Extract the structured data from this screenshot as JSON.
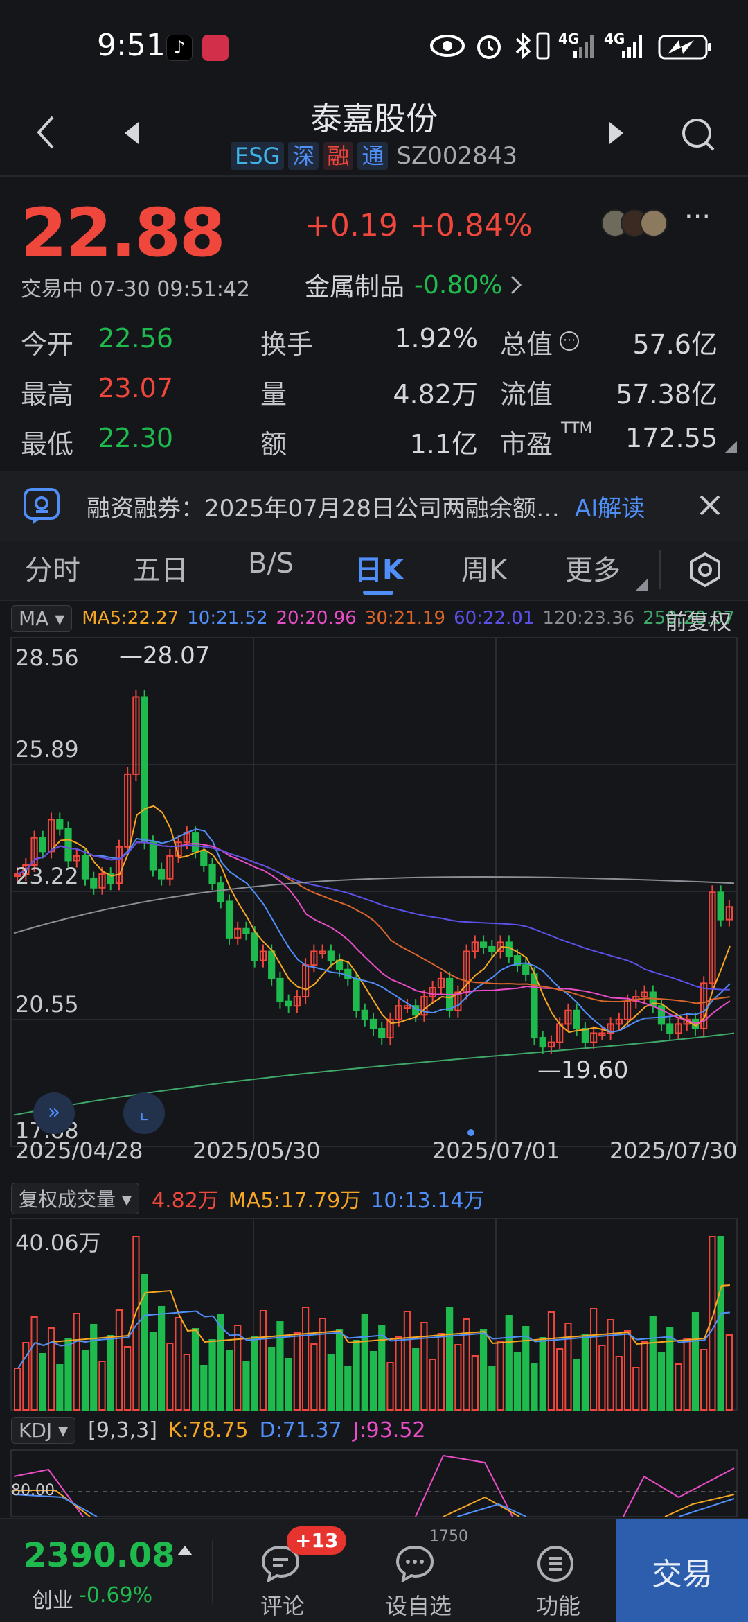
{
  "status_bar": {
    "time": "9:51",
    "net1": "4G",
    "net2": "4G"
  },
  "header": {
    "title": "泰嘉股份",
    "tags": [
      "ESG",
      "深",
      "融",
      "通"
    ],
    "code": "SZ002843"
  },
  "quote": {
    "price": "22.88",
    "change": "+0.19",
    "change_pct": "+0.84%",
    "status": "交易中 07-30 09:51:42",
    "sector": "金属制品",
    "sector_pct": "-0.80%"
  },
  "stats": [
    [
      {
        "label": "今开",
        "value": "22.56",
        "color": "green"
      },
      {
        "label": "换手",
        "value": "1.92%"
      },
      {
        "label": "总值",
        "value": "57.6亿"
      }
    ],
    [
      {
        "label": "最高",
        "value": "23.07",
        "color": "red"
      },
      {
        "label": "量",
        "value": "4.82万"
      },
      {
        "label": "流值",
        "value": "57.38亿"
      }
    ],
    [
      {
        "label": "最低",
        "value": "22.30",
        "color": "green"
      },
      {
        "label": "额",
        "value": "1.1亿"
      },
      {
        "label": "市盈",
        "value": "172.55",
        "sup": "TTM"
      }
    ]
  ],
  "banner": {
    "text": "融资融券：2025年07月28日公司两融余额…",
    "ai": "AI解读"
  },
  "tabs": [
    "分时",
    "五日",
    "B/S",
    "日K",
    "周K",
    "更多"
  ],
  "active_tab": "日K",
  "ma_row": {
    "dropdown": "MA",
    "items": [
      {
        "text": "MA5:22.27",
        "color": "#f5a623"
      },
      {
        "text": "10:21.52",
        "color": "#4f8ff7"
      },
      {
        "text": "20:20.96",
        "color": "#e94dc8"
      },
      {
        "text": "30:21.19",
        "color": "#d9662b"
      },
      {
        "text": "60:22.01",
        "color": "#5b50e8"
      },
      {
        "text": "120:23.36",
        "color": "#8d8f96"
      },
      {
        "text": "250:20.07",
        "color": "#3fa86a"
      }
    ],
    "adjust": "前复权"
  },
  "kline": {
    "y_labels": [
      "28.56",
      "25.89",
      "23.22",
      "20.55",
      "17.88"
    ],
    "high_marker": "28.07",
    "low_marker": "19.60",
    "dates": [
      "2025/04/28",
      "2025/05/30",
      "2025/07/01",
      "2025/07/30"
    ]
  },
  "vol_row": {
    "dropdown": "复权成交量",
    "items": [
      {
        "text": "4.82万",
        "color": "#f0473d"
      },
      {
        "text": "MA5:17.79万",
        "color": "#f5a623"
      },
      {
        "text": "10:13.14万",
        "color": "#4f8ff7"
      }
    ],
    "max_label": "40.06万"
  },
  "kdj_row": {
    "dropdown": "KDJ",
    "params": "[9,3,3]",
    "items": [
      {
        "text": "K:78.75",
        "color": "#f5a623"
      },
      {
        "text": "D:71.37",
        "color": "#4f8ff7"
      },
      {
        "text": "J:93.52",
        "color": "#e94dc8"
      }
    ],
    "level": "80.00"
  },
  "bottom_bar": {
    "index_value": "2390.08",
    "index_name": "创业",
    "index_pct": "-0.69%",
    "comment_label": "评论",
    "comment_badge": "+13",
    "watch_label": "设自选",
    "watch_count": "1750",
    "func_label": "功能",
    "trade_label": "交易"
  }
}
